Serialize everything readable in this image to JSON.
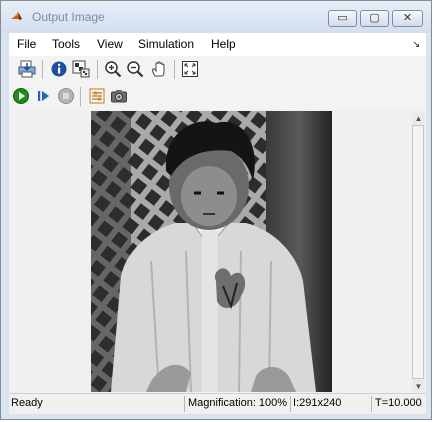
{
  "window": {
    "title": "Output Image",
    "minimize_glyph": "▭",
    "maximize_glyph": "▢",
    "close_glyph": "✕"
  },
  "menu": {
    "items": [
      "File",
      "Tools",
      "View",
      "Simulation",
      "Help"
    ],
    "overflow_glyph": "↘"
  },
  "toolbar1": {
    "icons": [
      "print-icon",
      "info-icon",
      "pixel-region-icon",
      "zoom-in-icon",
      "zoom-out-icon",
      "pan-hand-icon",
      "fit-to-window-icon"
    ]
  },
  "toolbar2": {
    "icons": [
      "run-icon",
      "step-forward-icon",
      "stop-icon",
      "settings-icon",
      "snapshot-icon"
    ]
  },
  "image": {
    "subject": "grayscale photo of a child in a light jacket in front of a lattice fence"
  },
  "status": {
    "state": "Ready",
    "magnification": "Magnification: 100%",
    "size": "I:291x240",
    "time": "T=10.000"
  },
  "colors": {
    "title_bar": "#d7e2f1",
    "title_text": "#7b8aa0",
    "run_green": "#1e8e1e",
    "info_blue": "#1f4fa0"
  }
}
